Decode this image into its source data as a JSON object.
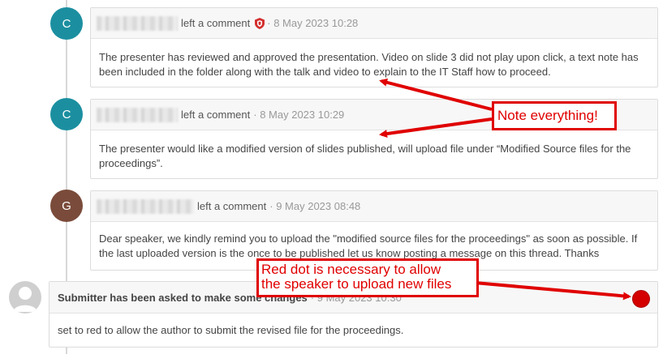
{
  "comments": [
    {
      "avatar": "C",
      "avatar_color": "#1b8fa0",
      "action": "left a comment",
      "time": "· 8 May 2023 10:28",
      "body": "The presenter has reviewed and approved the presentation. Video on slide 3 did not play upon click, a text note has been included in the folder along with the talk and video to explain to the IT Staff how to proceed."
    },
    {
      "avatar": "C",
      "avatar_color": "#1b8fa0",
      "action": "left a comment",
      "time": "· 8 May 2023 10:29",
      "body": "The presenter would like a modified version of slides published, will upload file under “Modified Source files for the proceedings”."
    },
    {
      "avatar": "G",
      "avatar_color": "#7a4b3a",
      "action": "left a comment",
      "time": "· 9 May 2023 08:48",
      "body": "Dear speaker, we kindly remind you to upload the \"modified source files for the proceedings\" as soon as possible. If the last uploaded version is the once to be published let us know posting a message on this thread. Thanks"
    }
  ],
  "status_entry": {
    "title": "Submitter has been asked to make some changes",
    "time": "· 9 May 2023 10:30",
    "body": "set to red to allow the author to submit the revised file for the proceedings.",
    "dot_color": "#d40000"
  },
  "annotations": {
    "note": "Note everything!",
    "red_dot_line1": "Red dot is necessary to allow",
    "red_dot_line2": "the speaker to upload new files"
  },
  "colors": {
    "annotation_red": "#e00000",
    "shield_red": "#d32f2f"
  }
}
